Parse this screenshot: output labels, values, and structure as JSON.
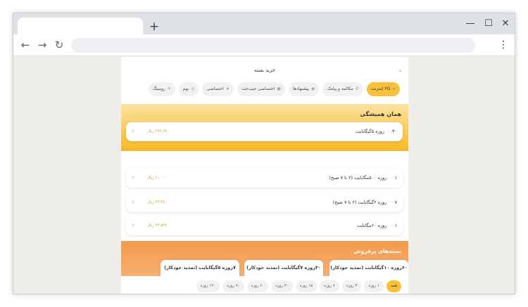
{
  "browser": {
    "new_tab_symbol": "+",
    "minimize_symbol": "—",
    "maximize_symbol": "☐",
    "close_symbol": "✕",
    "back_symbol": "←",
    "forward_symbol": "→",
    "reload_symbol": "↻",
    "menu_symbol": "⋮"
  },
  "page": {
    "title": "خرید بسته",
    "collapse_symbol": "⌄"
  },
  "categories": [
    {
      "label": "۴G اینترنت",
      "icon": "internet-icon",
      "active": true
    },
    {
      "label": "مکالمه و پیامک",
      "icon": "phone-icon",
      "active": false
    },
    {
      "label": "پیشنهادها",
      "icon": "offer-icon",
      "active": false
    },
    {
      "label": "اختصاصی جیب‌جت",
      "icon": "wallet-icon",
      "active": false
    },
    {
      "label": "اختصاصی",
      "icon": "star-icon",
      "active": false
    },
    {
      "label": "بوم",
      "icon": "boom-icon",
      "active": false
    },
    {
      "label": "رومینگ",
      "icon": "roaming-icon",
      "active": false
    }
  ],
  "featured": {
    "title": "همان همیشگی",
    "item": {
      "index": "۰۰",
      "name": "۳۰روزه ۵گیگابایت",
      "price": "۲۹۶,۲۸۰ ریال"
    }
  },
  "packages": [
    {
      "index": "۰۰",
      "name": "۱روزه ۵۰۰مگابایت (۲ تا ۷ صبح)",
      "price": "۶,۰۰۰ ریال"
    },
    {
      "index": "۰۰",
      "name": "۷روزه ۲گیگابایت (۲ تا ۷ صبح)",
      "price": "۲۳,۳۶۰ ریال"
    },
    {
      "index": "۰۰",
      "name": "۱روزه ۶۰مگابایت",
      "price": "۲۴,۵۴۸ ریال"
    }
  ],
  "bestseller": {
    "title": "بسته‌های پرفروش",
    "cards": [
      "۶۰روزه ۱۰گیگابایت (تمدید خودکار)",
      "۳۰روزه ۷گیگابایت (تمدید خودکار)",
      "۷روزه ۵گیگابایت (تمدید خودکار)"
    ]
  },
  "durations": [
    {
      "label": "همه",
      "active": true
    },
    {
      "label": "۱ روزه",
      "active": false
    },
    {
      "label": "۳ روزه",
      "active": false
    },
    {
      "label": "۷ روزه",
      "active": false
    },
    {
      "label": "۱۵ روزه",
      "active": false
    },
    {
      "label": "۳۰ روزه",
      "active": false
    },
    {
      "label": "۶۰ روزه",
      "active": false
    },
    {
      "label": "۹۰ روزه",
      "active": false
    },
    {
      "label": "۱۲۰ روزه",
      "active": false
    }
  ],
  "colors": {
    "accent": "#f9c03a",
    "bestseller": "#f39a4c",
    "price": "#c8a028"
  }
}
